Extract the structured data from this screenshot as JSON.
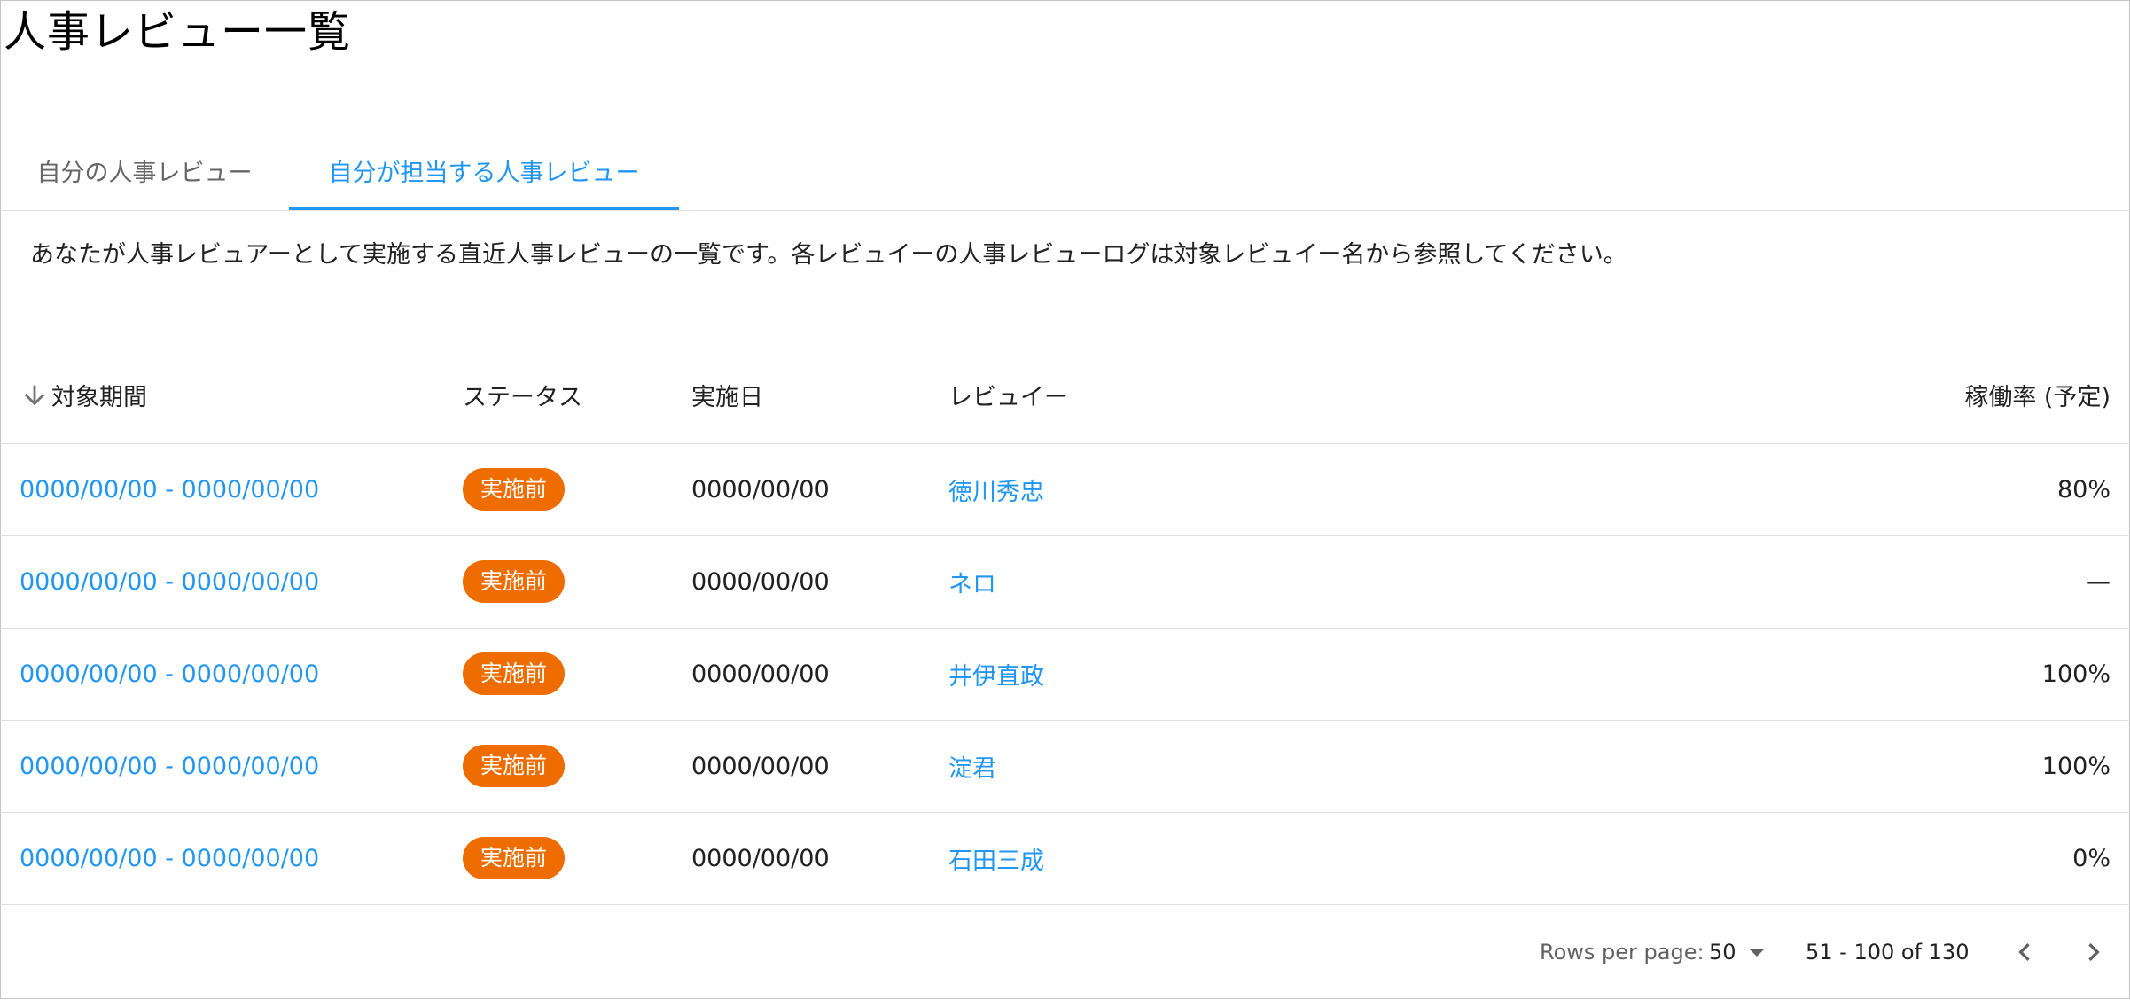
{
  "page": {
    "title": "人事レビュー一覧",
    "description": "あなたが人事レビュアーとして実施する直近人事レビューの一覧です。各レビュイーの人事レビューログは対象レビュイー名から参照してください。"
  },
  "tabs": [
    {
      "label": "自分の人事レビュー",
      "active": false
    },
    {
      "label": "自分が担当する人事レビュー",
      "active": true
    }
  ],
  "table": {
    "columns": [
      "対象期間",
      "ステータス",
      "実施日",
      "レビュイー",
      "稼働率 (予定)"
    ],
    "sort_column": "対象期間",
    "sort_direction": "descending",
    "rows": [
      {
        "period": "0000/00/00 - 0000/00/00",
        "status": "実施前",
        "date": "0000/00/00",
        "reviewee": "徳川秀忠",
        "utilization": "80%"
      },
      {
        "period": "0000/00/00 - 0000/00/00",
        "status": "実施前",
        "date": "0000/00/00",
        "reviewee": "ネロ",
        "utilization": "—"
      },
      {
        "period": "0000/00/00 - 0000/00/00",
        "status": "実施前",
        "date": "0000/00/00",
        "reviewee": "井伊直政",
        "utilization": "100%"
      },
      {
        "period": "0000/00/00 - 0000/00/00",
        "status": "実施前",
        "date": "0000/00/00",
        "reviewee": "淀君",
        "utilization": "100%"
      },
      {
        "period": "0000/00/00 - 0000/00/00",
        "status": "実施前",
        "date": "0000/00/00",
        "reviewee": "石田三成",
        "utilization": "0%"
      }
    ]
  },
  "pagination": {
    "rows_per_page_label": "Rows per page:",
    "rows_per_page": "50",
    "range": "51 - 100 of 130"
  },
  "icons": {
    "sort": "arrow-down-icon",
    "dropdown": "caret-down-icon",
    "prev": "chevron-left-icon",
    "next": "chevron-right-icon"
  },
  "colors": {
    "accent": "#2196f3",
    "status_badge": "#ef6c00",
    "divider": "#e0e0e0"
  }
}
